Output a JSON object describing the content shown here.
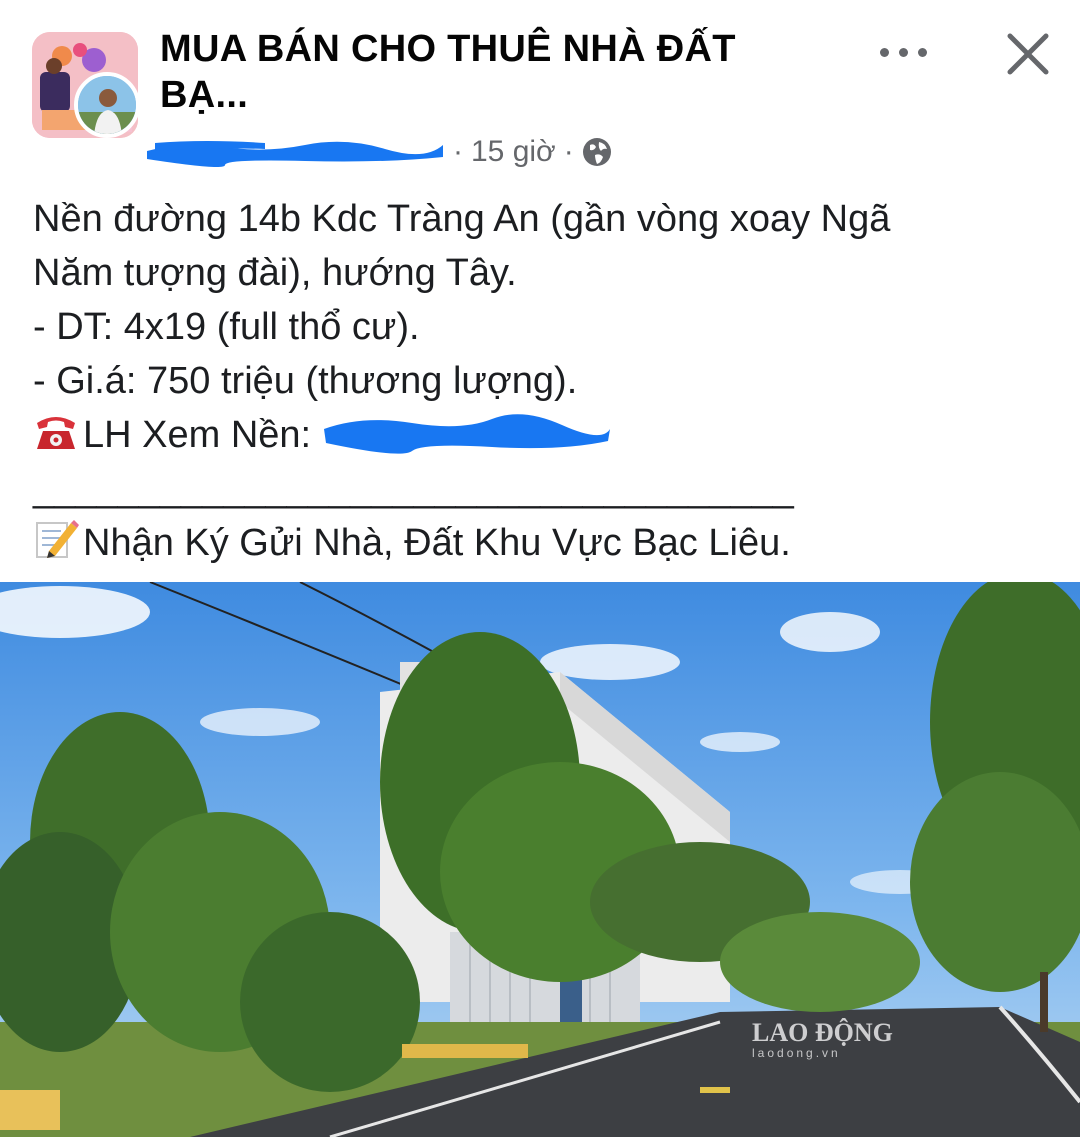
{
  "post": {
    "group_name": "MUA BÁN CHO THUÊ NHÀ ĐẤT BẠ...",
    "time_ago": "15 giờ",
    "separator": "·",
    "privacy_icon": "globe-icon",
    "more_icon": "more-horizontal-icon",
    "close_icon": "close-icon",
    "text_lines": [
      "Nền đường 14b Kdc Tràng An (gần vòng xoay Ngã",
      "Năm tượng đài), hướng Tây.",
      "- DT: 4x19 (full thổ cư).",
      "- Gi.á: 750 triệu (thương lượng).",
      "LH Xem Nền:",
      "____________________________________",
      "Nhận Ký Gửi Nhà, Đất Khu Vực Bạc Liêu."
    ]
  },
  "photo": {
    "watermark": "LAO ĐỘNG",
    "watermark_site": "laodong.vn"
  },
  "colors": {
    "text": "#1c1e21",
    "secondary": "#65676b",
    "redaction": "#1877f2"
  }
}
